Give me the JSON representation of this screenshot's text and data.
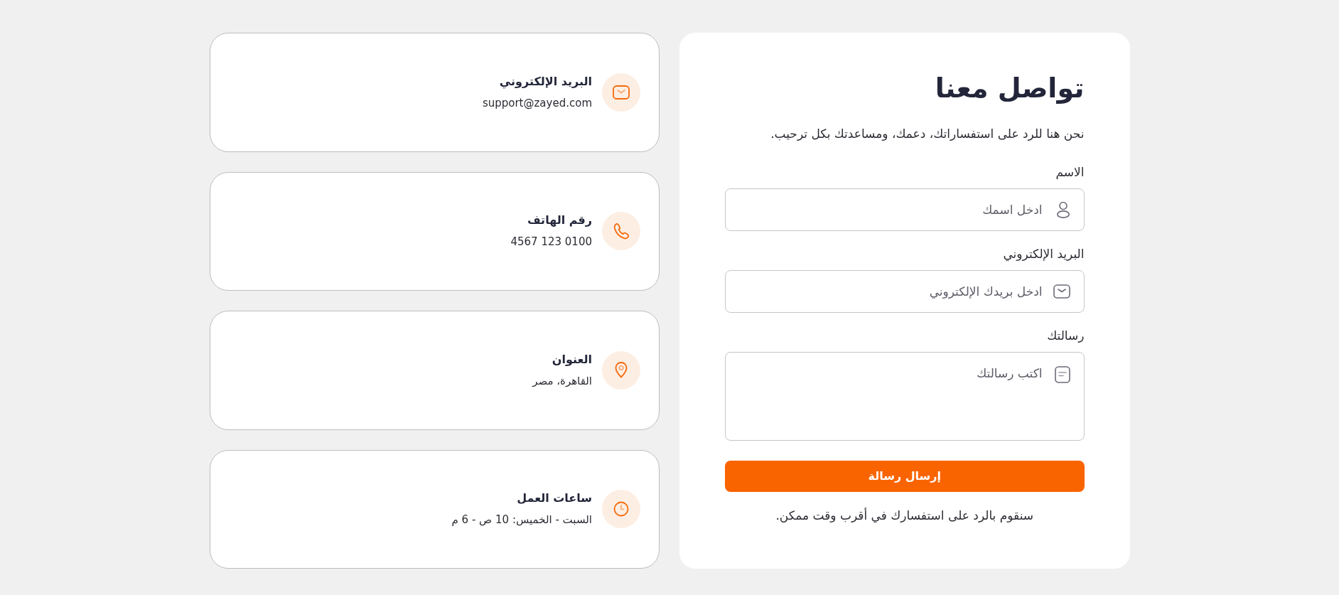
{
  "form": {
    "title": "تواصل معنا",
    "subtitle": "نحن هنا للرد على استفساراتك، دعمك، ومساعدتك بكل ترحيب.",
    "fields": [
      {
        "kind": "text",
        "label": "الاسم",
        "placeholder": "ادخل اسمك"
      },
      {
        "kind": "email",
        "label": "البريد الإلكتروني",
        "placeholder": "ادخل بريدك الإلكتروني"
      },
      {
        "kind": "textarea",
        "label": "رسالتك",
        "placeholder": "اكتب رسالتك"
      }
    ],
    "submit": "إرسال رسالة",
    "note": "سنقوم بالرد على استفسارك في أقرب وقت ممكن."
  },
  "contact_cards": [
    {
      "kind": "email",
      "title": "البريد الإلكتروني",
      "value": "support@zayed.com"
    },
    {
      "kind": "phone",
      "title": "رقم الهاتف",
      "value": "4567 123 0100"
    },
    {
      "kind": "address",
      "title": "العنوان",
      "value": "القاهرة، مصر"
    },
    {
      "kind": "hours",
      "title": "ساعات العمل",
      "value": "السبت - الخميس: 10 ص - 6 م"
    }
  ]
}
